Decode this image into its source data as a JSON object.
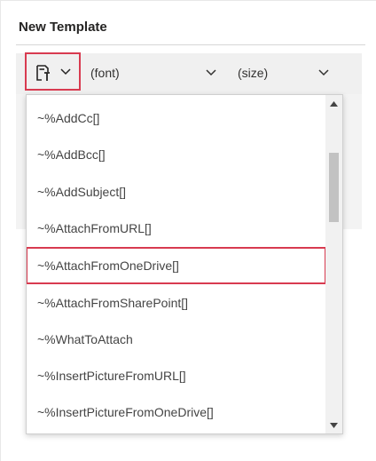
{
  "header": {
    "title": "New Template"
  },
  "toolbar": {
    "template_button_icon": "insert-template-icon",
    "font_select": {
      "value": "(font)"
    },
    "size_select": {
      "value": "(size)"
    }
  },
  "dropdown": {
    "items": [
      {
        "label": "~%AddCc[]"
      },
      {
        "label": "~%AddBcc[]"
      },
      {
        "label": "~%AddSubject[]"
      },
      {
        "label": "~%AttachFromURL[]"
      },
      {
        "label": "~%AttachFromOneDrive[]",
        "selected": true
      },
      {
        "label": "~%AttachFromSharePoint[]"
      },
      {
        "label": "~%WhatToAttach"
      },
      {
        "label": "~%InsertPictureFromURL[]"
      },
      {
        "label": "~%InsertPictureFromOneDrive[]"
      }
    ]
  },
  "colors": {
    "highlight": "#d83b50",
    "text": "#444444",
    "toolbar_bg": "#f0f0f0"
  }
}
